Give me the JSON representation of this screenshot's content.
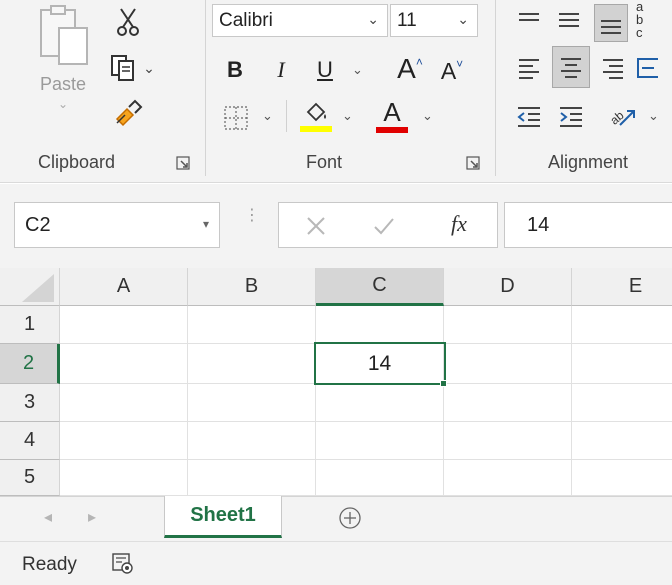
{
  "ribbon": {
    "clipboard": {
      "paste_label": "Paste",
      "group_label": "Clipboard"
    },
    "font": {
      "font_name": "Calibri",
      "font_size": "11",
      "bold": "B",
      "italic": "I",
      "underline": "U",
      "grow_font": "A",
      "shrink_font": "A",
      "font_color_letter": "A",
      "highlight_color": "#ffff00",
      "font_color": "#e00000",
      "group_label": "Font"
    },
    "alignment": {
      "group_label": "Alignment",
      "wrap_fragment": "ab c"
    }
  },
  "formula_bar": {
    "name_box": "C2",
    "fx": "fx",
    "value": "14"
  },
  "grid": {
    "columns": [
      "A",
      "B",
      "C",
      "D",
      "E"
    ],
    "rows": [
      "1",
      "2",
      "3",
      "4",
      "5"
    ],
    "selected_cell": "C2",
    "cells": {
      "C2": "14"
    }
  },
  "sheets": {
    "tabs": [
      "Sheet1"
    ],
    "active": "Sheet1"
  },
  "status": {
    "text": "Ready"
  },
  "colors": {
    "accent": "#217346"
  }
}
